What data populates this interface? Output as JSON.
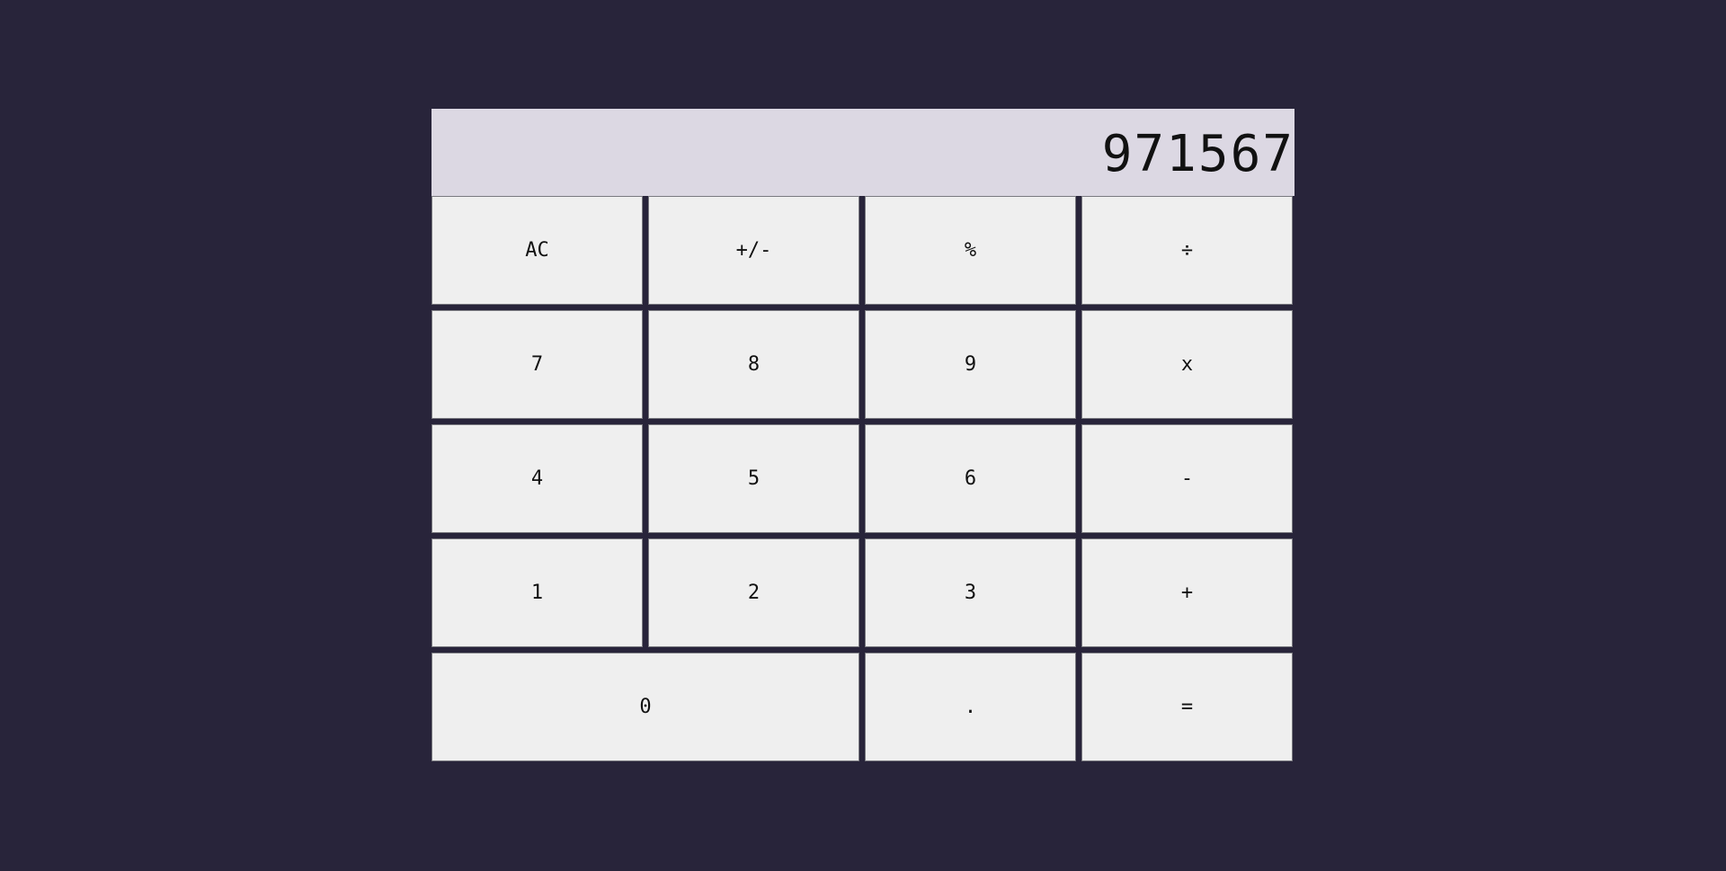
{
  "display": {
    "value": "971567"
  },
  "keys": {
    "ac": "AC",
    "sign": "+/-",
    "percent": "%",
    "divide": "÷",
    "seven": "7",
    "eight": "8",
    "nine": "9",
    "multiply": "x",
    "four": "4",
    "five": "5",
    "six": "6",
    "subtract": "-",
    "one": "1",
    "two": "2",
    "three": "3",
    "add": "+",
    "zero": "0",
    "decimal": ".",
    "equals": "="
  },
  "colors": {
    "background": "#28243a",
    "display": "#dcd8e3",
    "key": "#efefef"
  }
}
